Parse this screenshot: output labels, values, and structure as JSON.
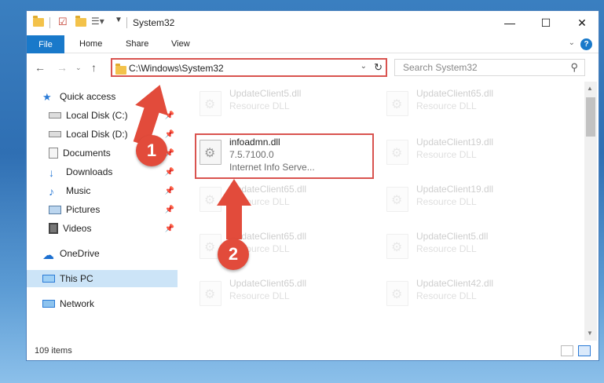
{
  "window": {
    "title": "System32",
    "controls": {
      "minimize": "—",
      "maximize": "☐",
      "close": "✕"
    }
  },
  "ribbon": {
    "tabs": [
      "File",
      "Home",
      "Share",
      "View"
    ],
    "help": "?"
  },
  "address": {
    "path": "C:\\Windows\\System32",
    "search_placeholder": "Search System32"
  },
  "nav_pane": {
    "items": [
      {
        "label": "Quick access",
        "icon": "star-icon"
      },
      {
        "label": "Local Disk (C:)",
        "icon": "drive-icon",
        "pinned": true
      },
      {
        "label": "Local Disk (D:)",
        "icon": "drive-icon",
        "pinned": true
      },
      {
        "label": "Documents",
        "icon": "documents-icon",
        "pinned": true
      },
      {
        "label": "Downloads",
        "icon": "download-icon",
        "pinned": true
      },
      {
        "label": "Music",
        "icon": "music-icon",
        "pinned": true
      },
      {
        "label": "Pictures",
        "icon": "pictures-icon",
        "pinned": true
      },
      {
        "label": "Videos",
        "icon": "videos-icon",
        "pinned": true
      },
      {
        "label": "OneDrive",
        "icon": "cloud-icon"
      },
      {
        "label": "This PC",
        "icon": "monitor-icon",
        "selected": true
      },
      {
        "label": "Network",
        "icon": "network-icon"
      }
    ]
  },
  "files": {
    "highlighted": {
      "name": "infoadmn.dll",
      "version": "7.5.7100.0",
      "description": "Internet Info Serve..."
    },
    "left_column": [
      {
        "name": "UpdateClient5.dll",
        "type": "Resource DLL"
      },
      {
        "name": "UpdateClient65.dll",
        "type": "Resource DLL"
      },
      {
        "name": "UpdateClient65.dll",
        "type": "Resource DLL"
      },
      {
        "name": "UpdateClient65.dll",
        "type": "Resource DLL"
      }
    ],
    "right_column": [
      {
        "name": "UpdateClient65.dll",
        "type": "Resource DLL"
      },
      {
        "name": "UpdateClient19.dll",
        "type": "Resource DLL"
      },
      {
        "name": "UpdateClient19.dll",
        "type": "Resource DLL"
      },
      {
        "name": "UpdateClient5.dll",
        "type": "Resource DLL"
      },
      {
        "name": "UpdateClient42.dll",
        "type": "Resource DLL"
      }
    ]
  },
  "status": {
    "items_count": "109 items"
  },
  "annotations": {
    "step1": "1",
    "step2": "2",
    "color": "#e24b3b"
  }
}
